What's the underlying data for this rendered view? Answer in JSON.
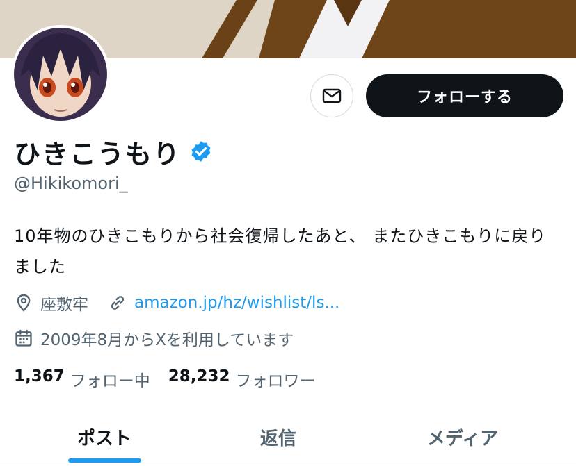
{
  "profile": {
    "display_name": "ひきこうもり",
    "handle": "@Hikikomori_",
    "bio": "10年物のひきこもりから社会復帰したあと、 またひきこもりに戻りました",
    "location": "座敷牢",
    "website": "amazon.jp/hz/wishlist/ls...",
    "joined": "2009年8月からXを利用しています"
  },
  "actions": {
    "message_icon": "envelope-icon",
    "follow_label": "フォローする"
  },
  "stats": {
    "following_count": "1,367",
    "following_label": "フォロー中",
    "followers_count": "28,232",
    "followers_label": "フォロワー"
  },
  "tabs": [
    {
      "label": "ポスト",
      "active": true
    },
    {
      "label": "返信",
      "active": false
    },
    {
      "label": "メディア",
      "active": false
    }
  ],
  "icons": {
    "verified": "verified-badge-icon",
    "location": "location-pin-icon",
    "link": "link-icon",
    "calendar": "calendar-icon"
  },
  "colors": {
    "accent": "#1d9bf0",
    "text": "#0f1419",
    "secondary_text": "#536471",
    "follow_button": "#0f1419"
  }
}
